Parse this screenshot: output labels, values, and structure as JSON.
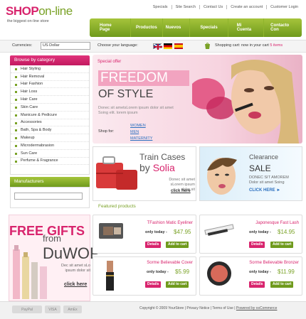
{
  "logo": {
    "part1": "SHOP",
    "part2": "on-line",
    "tagline": "the biggest on-line store"
  },
  "toplinks": [
    "Specials",
    "Site Search",
    "Contact Us",
    "Create an account",
    "Customer Login"
  ],
  "nav": [
    "Home Page",
    "Productos",
    "Nuevos",
    "Specials",
    "Mi Cuenta",
    "Contacto Con"
  ],
  "currency": {
    "label": "Currencies:",
    "value": "US Dollar"
  },
  "language": {
    "label": "Choose your language:"
  },
  "cart": {
    "label": "Shopping cart:",
    "text": "now in your cart",
    "count": "5 items"
  },
  "categories": {
    "title": "Browse by category",
    "items": [
      "Hair Styling",
      "Hair Removal",
      "Hair Fashion",
      "Hair Loss",
      "Hair Care",
      "Skin Care",
      "Manicure & Pedicure",
      "Accessories",
      "Bath, Spa & Body",
      "Makeup",
      "Microdermabrasion",
      "Sun Care",
      "Perfume & Fragrance"
    ]
  },
  "manufacturers": {
    "title": "Manufacturers"
  },
  "special": {
    "label": "Special offer",
    "line1": "FREEDOM",
    "line2": "OF STYLE",
    "desc": "Donec sit ametsLorem ipsum dolor sit amet Soing elit. lorem ipsum",
    "shop_for": "Shop for:",
    "links": [
      "WOMEN",
      "MEN",
      "MATERNITY"
    ]
  },
  "banner1": {
    "line1": "Train Cases",
    "by": "by ",
    "brand": "Solia",
    "desc": "Donec sit amet sLorem ipsum dolor sit",
    "link": "click here"
  },
  "banner2": {
    "line1": "Clearance",
    "line2": "SALE",
    "desc": "DONEC SIT AMOREM Dolor sit amet Soing",
    "link": "CLICK HERE ►"
  },
  "featured": {
    "title": "Featured products"
  },
  "freegifts": {
    "line1": "FREE GIFTS",
    "from": "from",
    "brand": "DuWOP",
    "desc": "Dec sit amet sLo ipsum dolor sit",
    "link": "click here"
  },
  "products": [
    {
      "name": "TFashion Matic Eyeliner",
      "today": "only today -",
      "price": "$47.95"
    },
    {
      "name": "Japonesque Fast Lash",
      "today": "only today -",
      "price": "$14.95"
    },
    {
      "name": "Sorme Believable Cover",
      "today": "only today -",
      "price": "$5.99"
    },
    {
      "name": "Sorme Believable Bronzer",
      "today": "only today -",
      "price": "$11.99"
    }
  ],
  "buttons": {
    "details": "Details",
    "add": "Add to cart"
  },
  "footer": {
    "text": "Copyright © 2009 YourStore | Privacy Notice | Terms of Use |",
    "powered": "Powered by osCommerce",
    "pay": [
      "PayPal",
      "VISA",
      "AmEx"
    ]
  }
}
